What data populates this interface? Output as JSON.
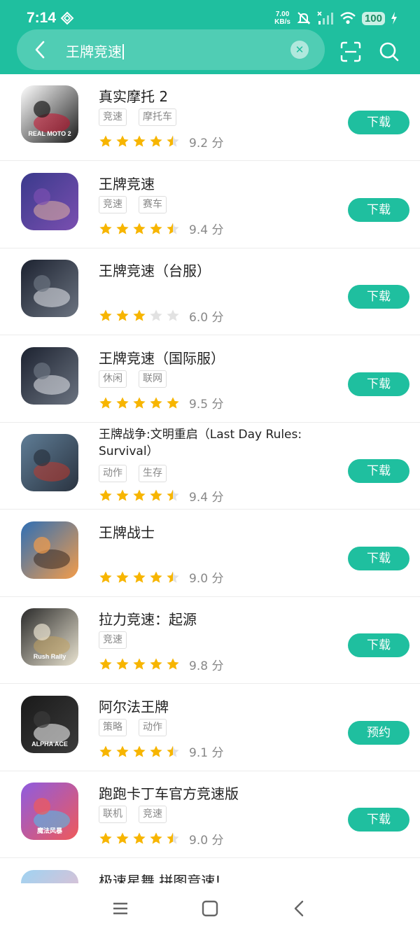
{
  "status": {
    "time": "7:14",
    "net_speed_value": "7.00",
    "net_speed_unit": "KB/s",
    "battery": "100"
  },
  "search": {
    "query": "王牌竞速"
  },
  "apps": [
    {
      "name": "真实摩托 2",
      "tags": [
        "竞速",
        "摩托车"
      ],
      "rating": 4.5,
      "score": "9.2 分",
      "button": "下载",
      "icon_colors": [
        "#ffffff",
        "#1b1b1b",
        "#c8102e"
      ],
      "icon_label": "REAL MOTO 2"
    },
    {
      "name": "王牌竞速",
      "tags": [
        "竞速",
        "赛车"
      ],
      "rating": 4.5,
      "score": "9.4 分",
      "button": "下载",
      "icon_colors": [
        "#3a3a8c",
        "#7a4fb0",
        "#e3b3a0"
      ],
      "icon_label": ""
    },
    {
      "name": "王牌竞速（台服）",
      "tags": [],
      "rating": 3,
      "score": "6.0 分",
      "button": "下载",
      "icon_colors": [
        "#1c2230",
        "#6b7380",
        "#e6e8ec"
      ],
      "icon_label": ""
    },
    {
      "name": "王牌竞速（国际服）",
      "tags": [
        "休闲",
        "联网"
      ],
      "rating": 5,
      "score": "9.5 分",
      "button": "下载",
      "icon_colors": [
        "#1c2230",
        "#6b7380",
        "#e6e8ec"
      ],
      "icon_label": ""
    },
    {
      "name": "王牌战争:文明重启（Last Day Rules: Survival）",
      "tags": [
        "动作",
        "生存"
      ],
      "rating": 4.5,
      "score": "9.4 分",
      "button": "下载",
      "icon_colors": [
        "#5f7d96",
        "#2a3340",
        "#c0392b"
      ],
      "icon_label": ""
    },
    {
      "name": "王牌战士",
      "tags": [],
      "rating": 4.5,
      "score": "9.0 分",
      "button": "下载",
      "icon_colors": [
        "#2f6fb5",
        "#f39c4a",
        "#3a2a20"
      ],
      "icon_label": ""
    },
    {
      "name": "拉力竞速：起源",
      "tags": [
        "竞速"
      ],
      "rating": 5,
      "score": "9.8 分",
      "button": "下载",
      "icon_colors": [
        "#2b2b2b",
        "#e9e3d0",
        "#c0a060"
      ],
      "icon_label": "Rush Rally"
    },
    {
      "name": "阿尔法王牌",
      "tags": [
        "策略",
        "动作"
      ],
      "rating": 4.5,
      "score": "9.1 分",
      "button": "预约",
      "icon_colors": [
        "#1a1a1a",
        "#3b3b3b",
        "#ffffff"
      ],
      "icon_label": "ALPHA ACE"
    },
    {
      "name": "跑跑卡丁车官方竞速版",
      "tags": [
        "联机",
        "竞速"
      ],
      "rating": 4.5,
      "score": "9.0 分",
      "button": "下载",
      "icon_colors": [
        "#8e5be0",
        "#ef5a5a",
        "#48c2ef"
      ],
      "icon_label": "魔法风暴"
    },
    {
      "name": "极速星舞 拼图竞速!",
      "tags": [],
      "rating": 0,
      "score": "",
      "button": "",
      "icon_colors": [
        "#9fd3f2",
        "#f5b8c8",
        "#ffffff"
      ],
      "icon_label": ""
    }
  ],
  "colors": {
    "accent": "#1fbf9f",
    "star": "#f7b500",
    "star_empty": "#e2e2e2"
  },
  "icons": [
    "back-arrow-icon",
    "clear-icon",
    "scan-icon",
    "search-icon",
    "menu-icon",
    "home-icon",
    "back-icon"
  ]
}
